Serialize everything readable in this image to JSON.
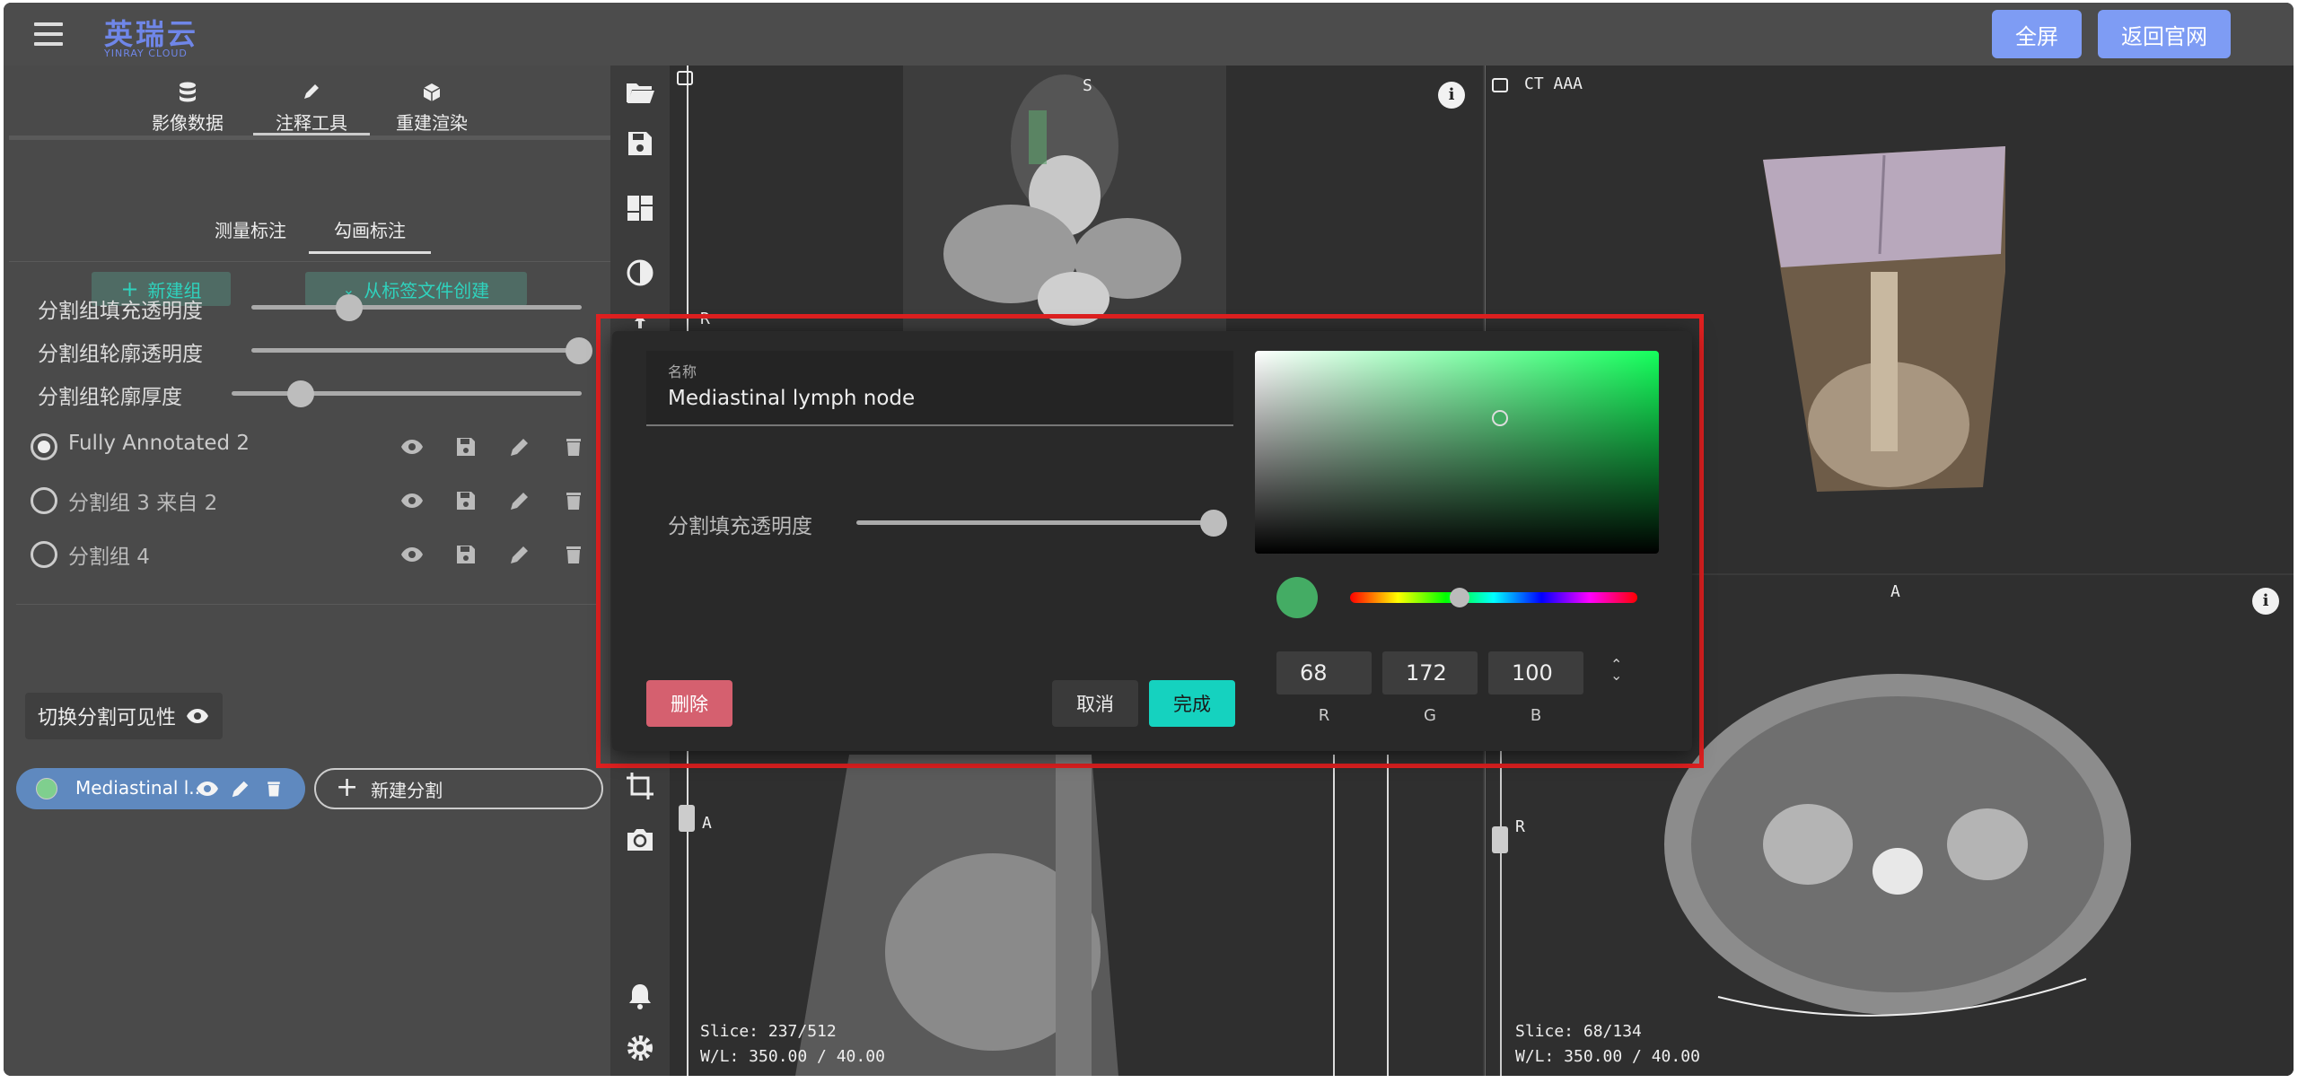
{
  "header": {
    "logo_text": "英瑞云",
    "logo_subtext": "YINRAY CLOUD",
    "fullscreen_label": "全屏",
    "back_label": "返回官网"
  },
  "sidebar": {
    "main_tabs": [
      "影像数据",
      "注释工具",
      "重建渲染"
    ],
    "active_main_tab": "注释工具",
    "sub_tabs": [
      "测量标注",
      "勾画标注"
    ],
    "active_sub_tab": "勾画标注",
    "new_group_label": "新建组",
    "from_label_file_label": "从标签文件创建",
    "sliders": [
      {
        "label": "分割组填充透明度",
        "value": 0.32
      },
      {
        "label": "分割组轮廓透明度",
        "value": 1.0
      },
      {
        "label": "分割组轮廓厚度",
        "value": 0.2
      }
    ],
    "groups": [
      {
        "name": "Fully Annotated 2",
        "selected": true
      },
      {
        "name": "分割组 3 来自 2",
        "selected": false
      },
      {
        "name": "分割组 4",
        "selected": false
      }
    ],
    "toggle_visibility_label": "切换分割可见性",
    "segment_chip_label": "Mediastinal l...",
    "new_segment_label": "新建分割"
  },
  "viewports": {
    "top_left": {
      "orientation_top": "S",
      "orientation_left": "R"
    },
    "top_right": {
      "title": "CT AAA"
    },
    "bottom_left": {
      "orientation_left": "A",
      "slice": "Slice: 237/512",
      "wl": "W/L: 350.00 / 40.00"
    },
    "bottom_right": {
      "orientation_top": "A",
      "orientation_left": "R",
      "slice": "Slice: 68/134",
      "wl": "W/L: 350.00 / 40.00"
    }
  },
  "dialog": {
    "name_label": "名称",
    "name_value": "Mediastinal lymph node",
    "fill_opacity_label": "分割填充透明度",
    "fill_opacity_value": 1.0,
    "delete_label": "删除",
    "cancel_label": "取消",
    "done_label": "完成",
    "color_hex": "#44ac64",
    "hue_position": 0.38,
    "rgb": {
      "r": "68",
      "g": "172",
      "b": "100"
    },
    "rgb_labels": [
      "R",
      "G",
      "B"
    ]
  },
  "colors": {
    "accent_teal": "#2fd2bd",
    "header_button": "#7e9cf4",
    "delete_red": "#d5606f",
    "done_teal": "#15d2bf",
    "segment_chip_blue": "#5f89bf",
    "highlight_outline": "#e02020"
  }
}
